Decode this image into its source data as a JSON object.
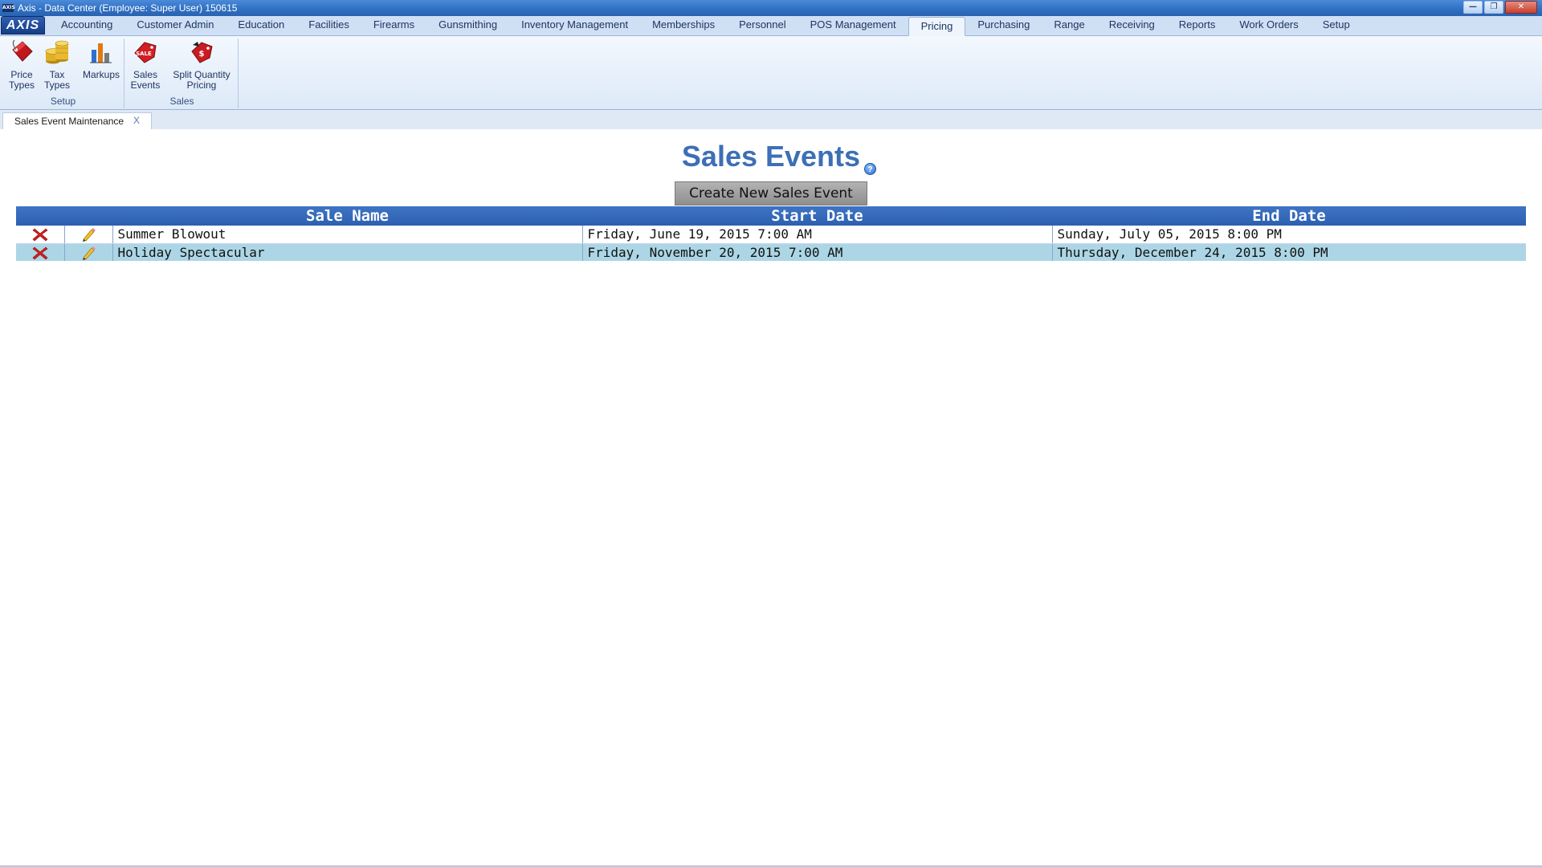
{
  "window": {
    "logo_text": "AXIS",
    "title": "Axis - Data Center  (Employee: Super User) 150615",
    "controls": [
      "minimize",
      "restore",
      "close"
    ]
  },
  "ribbon": {
    "app_button": "AXIS",
    "tabs": [
      "Accounting",
      "Customer Admin",
      "Education",
      "Facilities",
      "Firearms",
      "Gunsmithing",
      "Inventory Management",
      "Memberships",
      "Personnel",
      "POS Management",
      "Pricing",
      "Purchasing",
      "Range",
      "Receiving",
      "Reports",
      "Work Orders",
      "Setup"
    ],
    "active_tab": "Pricing",
    "groups": {
      "setup": {
        "label": "Setup",
        "buttons": {
          "price_types": {
            "line1": "Price",
            "line2": "Types",
            "icon": "price-tag-icon"
          },
          "tax_types": {
            "line1": "Tax",
            "line2": "Types",
            "icon": "coins-icon"
          },
          "markups": {
            "line1": "Markups",
            "line2": "",
            "icon": "bar-chart-icon"
          }
        }
      },
      "sales": {
        "label": "Sales",
        "buttons": {
          "sales_events": {
            "line1": "Sales",
            "line2": "Events",
            "icon": "sale-tag-icon",
            "badge": "SALE"
          },
          "split_qty": {
            "line1": "Split Quantity",
            "line2": "Pricing",
            "icon": "split-price-tag-icon",
            "badge": "$"
          }
        }
      }
    }
  },
  "document_tab": {
    "label": "Sales Event Maintenance",
    "close": "X"
  },
  "main": {
    "title": "Sales Events",
    "help": "?",
    "create_button": "Create New Sales Event",
    "columns": [
      "Sale Name",
      "Start Date",
      "End Date"
    ],
    "rows": [
      {
        "name": "Summer Blowout",
        "start": "Friday, June 19, 2015 7:00 AM",
        "end": "Sunday, July 05, 2015 8:00 PM"
      },
      {
        "name": "Holiday Spectacular",
        "start": "Friday, November 20, 2015 7:00 AM",
        "end": "Thursday, December 24, 2015 8:00 PM"
      }
    ]
  },
  "colors": {
    "header_blue": "#2c5faf",
    "title_blue": "#3d6fb6",
    "row_highlight": "#acd6e5",
    "delete_red": "#d42020"
  }
}
